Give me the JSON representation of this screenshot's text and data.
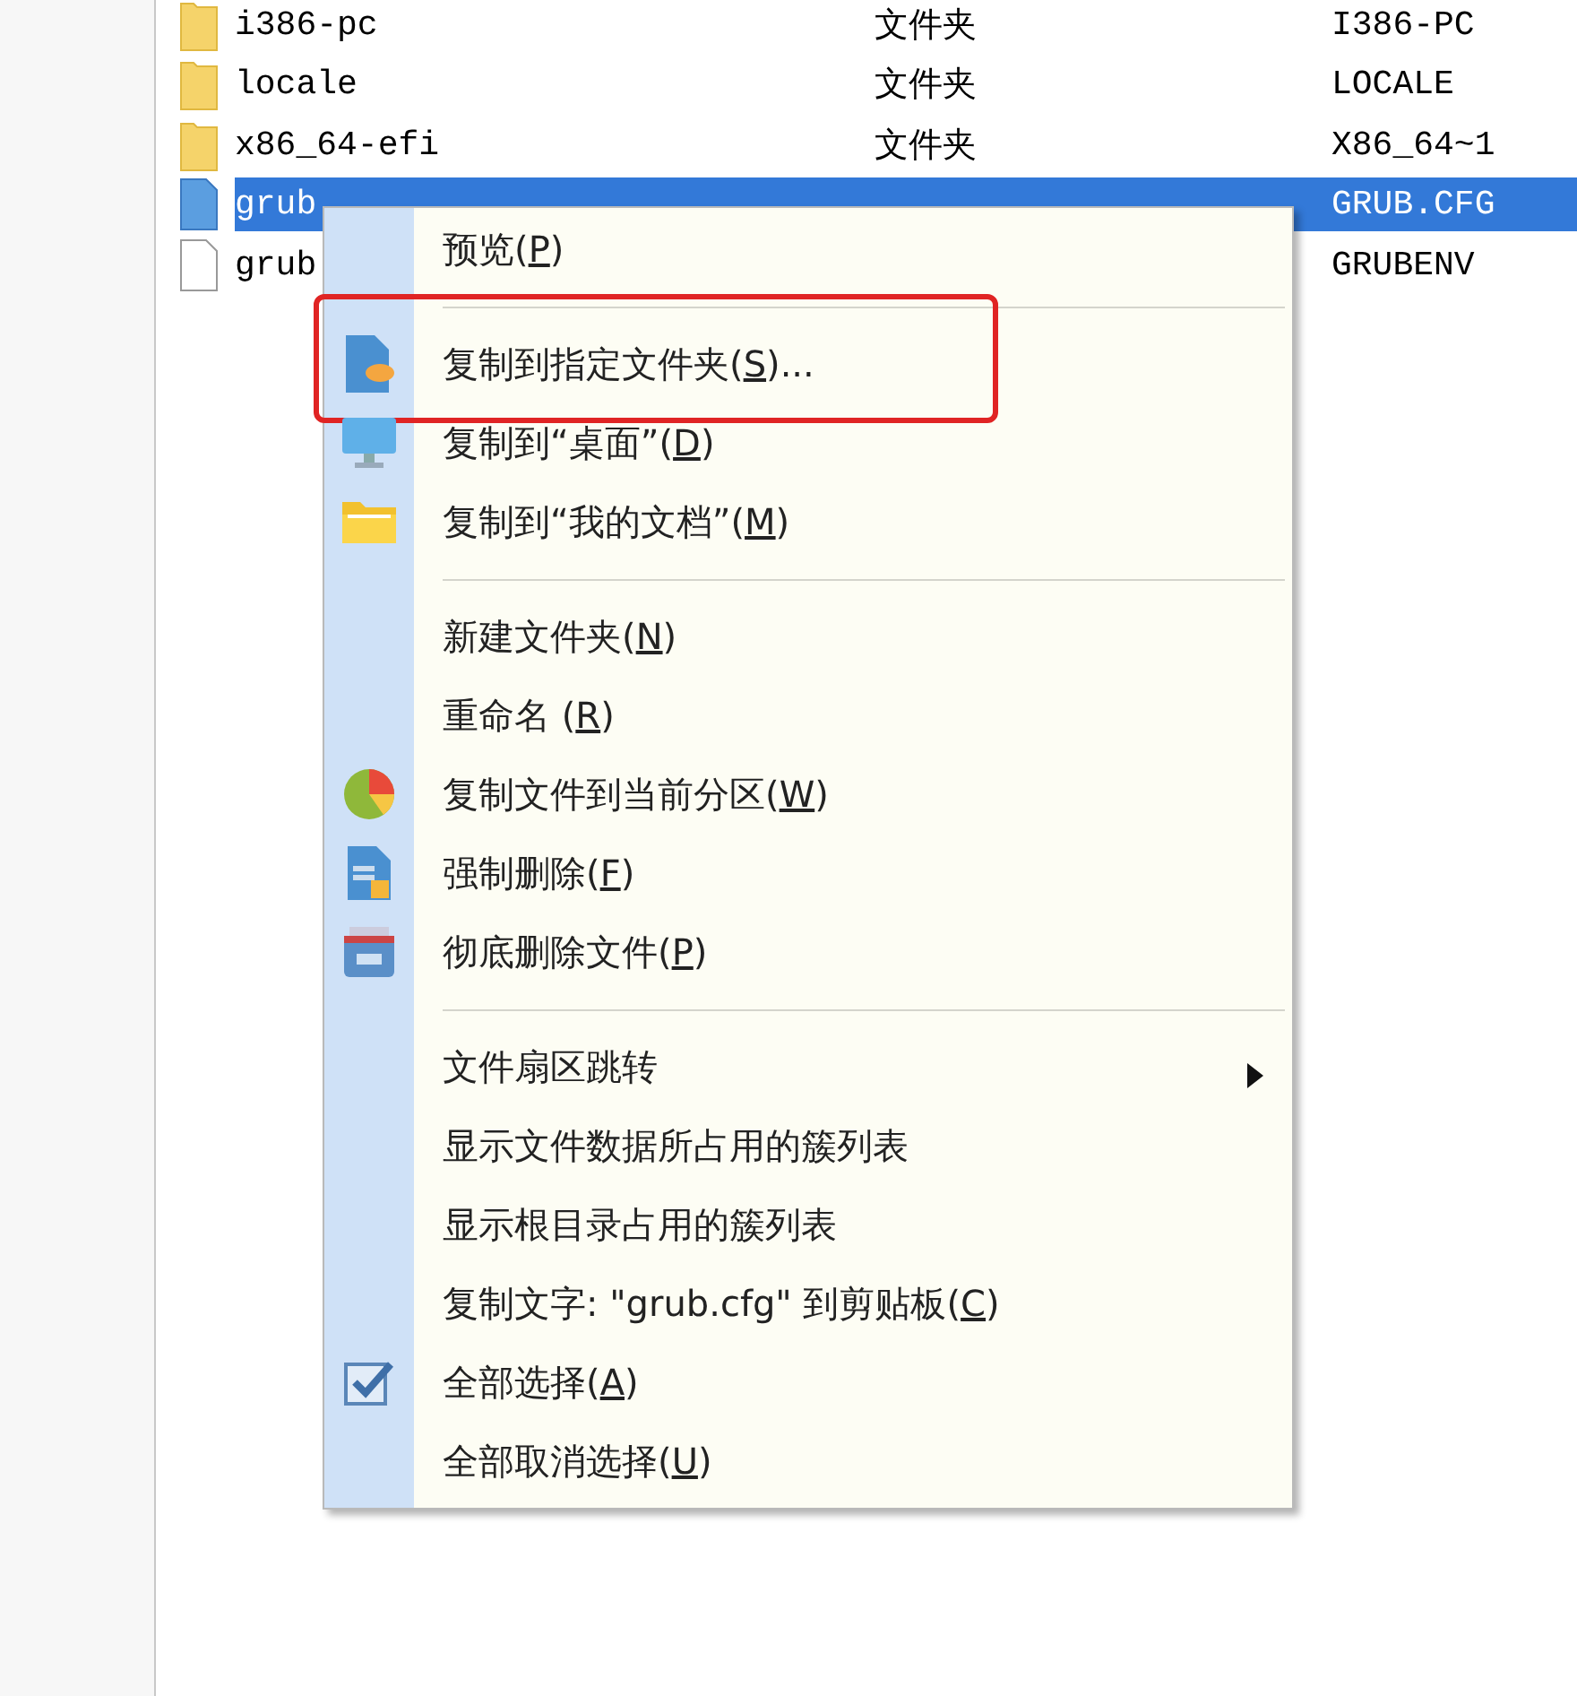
{
  "files": [
    {
      "kind": "folder",
      "name": "i386-pc",
      "type": "文件夹",
      "short_name": "I386-PC",
      "selected": false
    },
    {
      "kind": "folder",
      "name": "locale",
      "type": "文件夹",
      "short_name": "LOCALE",
      "selected": false
    },
    {
      "kind": "folder",
      "name": "x86_64-efi",
      "type": "文件夹",
      "short_name": "X86_64~1",
      "selected": false
    },
    {
      "kind": "file",
      "name": "grub",
      "short_name": "GRUB.CFG",
      "selected": true
    },
    {
      "kind": "file",
      "name": "grub",
      "short_name": "GRUBENV",
      "selected": false
    }
  ],
  "menu": {
    "sections": [
      {
        "items": [
          {
            "before": "预览(",
            "accel": "P",
            "after": ")",
            "annotated": false,
            "has_submenu": false
          }
        ]
      },
      {
        "items": [
          {
            "before": "复制到指定文件夹(",
            "accel": "S",
            "after": ")...",
            "annotated": true,
            "has_submenu": false
          },
          {
            "before": "复制到“桌面”(",
            "accel": "D",
            "after": ")",
            "annotated": false,
            "has_submenu": false
          },
          {
            "before": "复制到“我的文档”(",
            "accel": "M",
            "after": ")",
            "annotated": false,
            "has_submenu": false
          }
        ]
      },
      {
        "items": [
          {
            "before": "新建文件夹(",
            "accel": "N",
            "after": ")",
            "annotated": false,
            "has_submenu": false
          },
          {
            "before": "重命名 (",
            "accel": "R",
            "after": ")",
            "annotated": false,
            "has_submenu": false
          },
          {
            "before": "复制文件到当前分区(",
            "accel": "W",
            "after": ")",
            "annotated": false,
            "has_submenu": false
          },
          {
            "before": "强制删除(",
            "accel": "F",
            "after": ")",
            "annotated": false,
            "has_submenu": false
          },
          {
            "before": "彻底删除文件(",
            "accel": "P",
            "after": ")",
            "annotated": false,
            "has_submenu": false
          }
        ]
      },
      {
        "items": [
          {
            "before": "文件扇区跳转",
            "annotated": false,
            "has_submenu": true
          },
          {
            "before": "显示文件数据所占用的簇列表",
            "annotated": false,
            "has_submenu": false
          },
          {
            "before": "显示根目录占用的簇列表",
            "annotated": false,
            "has_submenu": false
          },
          {
            "before": "复制文字: \"grub.cfg\" 到剪贴板(",
            "accel": "C",
            "after": ")",
            "annotated": false,
            "has_submenu": false
          },
          {
            "before": "全部选择(",
            "accel": "A",
            "after": ")",
            "annotated": false,
            "has_submenu": false
          },
          {
            "before": "全部取消选择(",
            "accel": "U",
            "after": ")",
            "annotated": false,
            "has_submenu": false
          }
        ]
      }
    ]
  }
}
